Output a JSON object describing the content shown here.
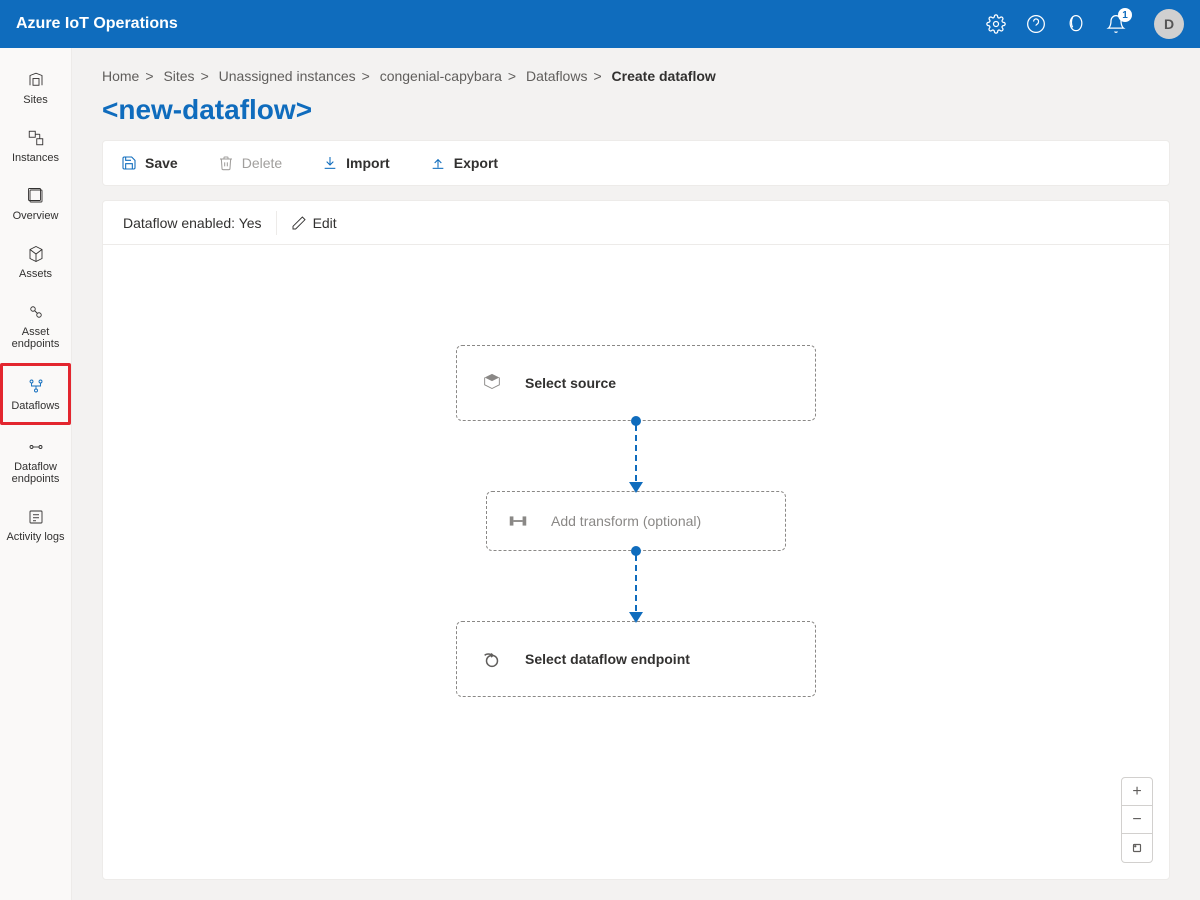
{
  "header": {
    "title": "Azure IoT Operations",
    "notifications_count": "1",
    "avatar_initial": "D"
  },
  "sidebar": {
    "items": [
      {
        "label": "Sites",
        "icon": "sites"
      },
      {
        "label": "Instances",
        "icon": "instances"
      },
      {
        "label": "Overview",
        "icon": "overview"
      },
      {
        "label": "Assets",
        "icon": "assets"
      },
      {
        "label": "Asset endpoints",
        "icon": "asset-endpoints"
      },
      {
        "label": "Dataflows",
        "icon": "dataflows",
        "active": true,
        "highlight": true
      },
      {
        "label": "Dataflow endpoints",
        "icon": "dataflow-endpoints"
      },
      {
        "label": "Activity logs",
        "icon": "activity-logs"
      }
    ]
  },
  "breadcrumb": {
    "items": [
      "Home",
      "Sites",
      "Unassigned instances",
      "congenial-capybara",
      "Dataflows"
    ],
    "current": "Create dataflow"
  },
  "page": {
    "title": "<new-dataflow>"
  },
  "toolbar": {
    "save_label": "Save",
    "delete_label": "Delete",
    "import_label": "Import",
    "export_label": "Export"
  },
  "status": {
    "enabled_label": "Dataflow enabled: Yes",
    "edit_label": "Edit"
  },
  "flow": {
    "source_label": "Select source",
    "transform_label": "Add transform (optional)",
    "endpoint_label": "Select dataflow endpoint"
  }
}
